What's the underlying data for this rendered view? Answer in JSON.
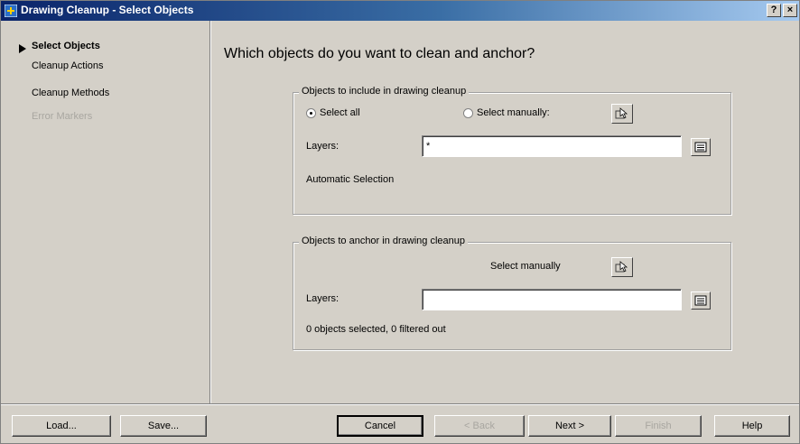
{
  "window": {
    "title": "Drawing Cleanup - Select Objects",
    "help_glyph": "?",
    "close_glyph": "×"
  },
  "sidebar": {
    "items": [
      {
        "label": "Select Objects",
        "state": "active"
      },
      {
        "label": "Cleanup Actions",
        "state": "enabled"
      },
      {
        "label": "Cleanup Methods",
        "state": "enabled"
      },
      {
        "label": "Error Markers",
        "state": "disabled"
      }
    ]
  },
  "main": {
    "heading": "Which objects do you want to clean and anchor?",
    "include": {
      "legend": "Objects to include in drawing cleanup",
      "radio_all": "Select all",
      "radio_manual": "Select manually:",
      "selected": "Select all",
      "layers_label": "Layers:",
      "layers_value": "*",
      "status": "Automatic Selection"
    },
    "anchor": {
      "legend": "Objects to anchor in drawing cleanup",
      "select_manually": "Select manually",
      "layers_label": "Layers:",
      "layers_value": "",
      "status": "0 objects selected, 0 filtered out"
    }
  },
  "footer": {
    "load": "Load...",
    "save": "Save...",
    "cancel": "Cancel",
    "back": "< Back",
    "next": "Next >",
    "finish": "Finish",
    "help": "Help"
  },
  "icons": {
    "app": "drawing-cleanup-app-icon",
    "pick": "pick-objects-icon",
    "layer": "layer-list-icon"
  },
  "colors": {
    "titlebar_start": "#0a246a",
    "titlebar_end": "#a6caf0",
    "dialog_bg": "#d4d0c8",
    "disabled_text": "#a8a6a0"
  }
}
